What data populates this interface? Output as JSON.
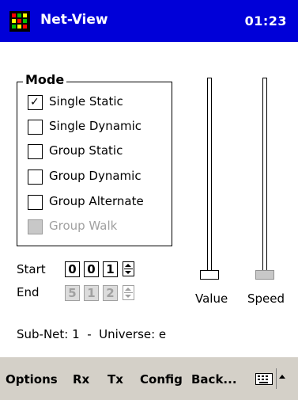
{
  "titlebar": {
    "app_name": "Net-View",
    "time": "01:23",
    "icon": "colorful-grid-app-icon"
  },
  "mode": {
    "label": "Mode",
    "options": [
      {
        "label": "Single Static",
        "checked": true,
        "enabled": true
      },
      {
        "label": "Single Dynamic",
        "checked": false,
        "enabled": true
      },
      {
        "label": "Group Static",
        "checked": false,
        "enabled": true
      },
      {
        "label": "Group Dynamic",
        "checked": false,
        "enabled": true
      },
      {
        "label": "Group Alternate",
        "checked": false,
        "enabled": true
      },
      {
        "label": "Group Walk",
        "checked": false,
        "enabled": false
      }
    ]
  },
  "start": {
    "label": "Start",
    "digits": [
      "0",
      "0",
      "1"
    ],
    "enabled": true
  },
  "end": {
    "label": "End",
    "digits": [
      "5",
      "1",
      "2"
    ],
    "enabled": false
  },
  "sliders": {
    "value": {
      "label": "Value",
      "enabled": true
    },
    "speed": {
      "label": "Speed",
      "enabled": false
    }
  },
  "status": {
    "text": "Sub-Net: 1  -  Universe: e"
  },
  "menubar": {
    "items": [
      "Options",
      "Rx",
      "Tx",
      "Config",
      "Back..."
    ],
    "keyboard_icon": "keyboard-icon",
    "sip_icon": "up-arrow-icon"
  },
  "colors": {
    "titlebar_bg": "#0000d8",
    "menubar_bg": "#d4d0c8",
    "disabled_text": "#a0a0a0"
  }
}
